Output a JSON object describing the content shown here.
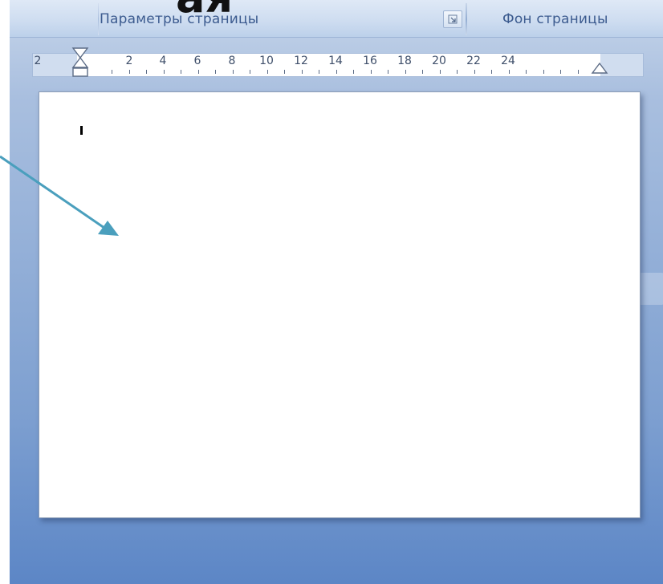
{
  "slide": {
    "heading_fragment": "ая"
  },
  "ribbon": {
    "page_setup_label": "Параметры страницы",
    "page_background_label": "Фон страницы",
    "dialog_launcher_icon": "dialog-launcher-icon"
  },
  "ruler": {
    "labels": [
      "2",
      "2",
      "4",
      "6",
      "8",
      "10",
      "12",
      "14",
      "16",
      "18",
      "20",
      "22",
      "24"
    ]
  },
  "colors": {
    "annotation_arrow": "#4a9fbd",
    "ruler_label": "#3f4f6a",
    "ribbon_label": "#3c5b8f"
  }
}
